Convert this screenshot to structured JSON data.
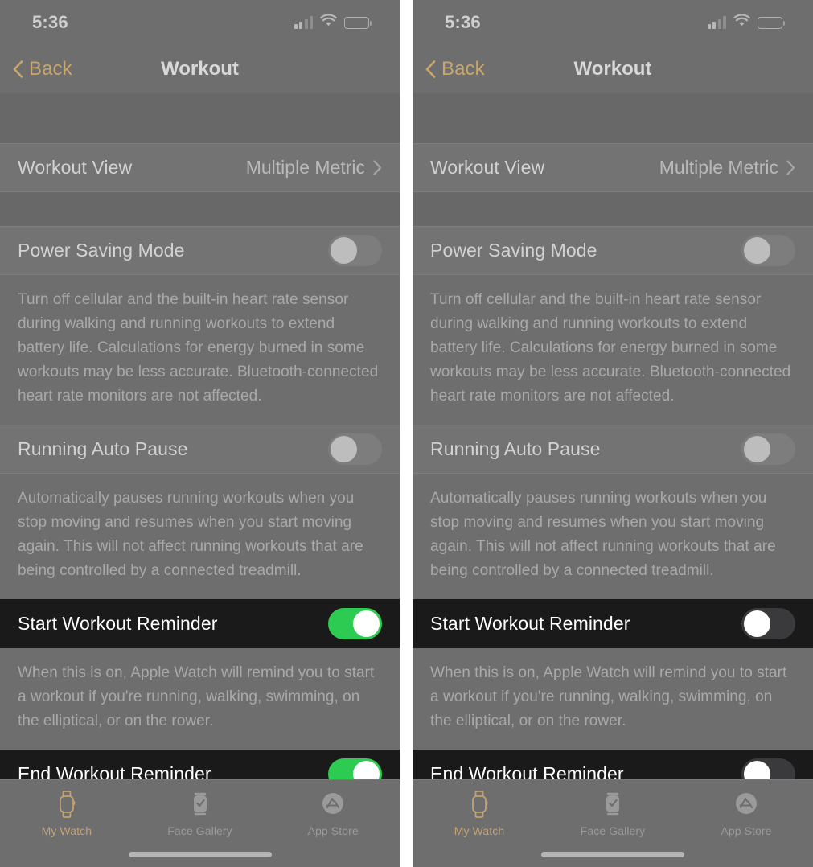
{
  "screens": [
    {
      "id": "left",
      "status_bar": {
        "time": "5:36",
        "cellular_icon": "cellular-signal-icon",
        "wifi_icon": "wifi-icon",
        "battery_icon": "battery-icon",
        "battery_level_pct": 50
      },
      "nav": {
        "back_label": "Back",
        "back_icon": "chevron-left-icon",
        "title": "Workout"
      },
      "rows": [
        {
          "key": "workout_view",
          "label": "Workout View",
          "value": "Multiple Metric",
          "accessory": "chevron-right-icon",
          "type": "disclosure",
          "highlighted": false
        },
        {
          "key": "power_saving_mode",
          "label": "Power Saving Mode",
          "type": "toggle",
          "toggle_state": "off",
          "highlighted": false,
          "description": "Turn off cellular and the built-in heart rate sensor during walking and running workouts to extend battery life. Calculations for energy burned in some workouts may be less accurate. Bluetooth-connected heart rate monitors are not affected."
        },
        {
          "key": "running_auto_pause",
          "label": "Running Auto Pause",
          "type": "toggle",
          "toggle_state": "off",
          "highlighted": false,
          "description": "Automatically pauses running workouts when you stop moving and resumes when you start moving again. This will not affect running workouts that are being controlled by a connected treadmill."
        },
        {
          "key": "start_workout_reminder",
          "label": "Start Workout Reminder",
          "type": "toggle",
          "toggle_state": "on",
          "highlighted": true,
          "description": "When this is on, Apple Watch will remind you to start a workout if you're running, walking, swimming, on the elliptical, or on the rower."
        },
        {
          "key": "end_workout_reminder",
          "label": "End Workout Reminder",
          "type": "toggle",
          "toggle_state": "on",
          "highlighted": true
        }
      ],
      "tabs": [
        {
          "label": "My Watch",
          "icon": "apple-watch-icon",
          "selected": true
        },
        {
          "label": "Face Gallery",
          "icon": "watch-face-icon",
          "selected": false
        },
        {
          "label": "App Store",
          "icon": "app-store-icon",
          "selected": false
        }
      ]
    },
    {
      "id": "right",
      "status_bar": {
        "time": "5:36",
        "cellular_icon": "cellular-signal-icon",
        "wifi_icon": "wifi-icon",
        "battery_icon": "battery-icon",
        "battery_level_pct": 50
      },
      "nav": {
        "back_label": "Back",
        "back_icon": "chevron-left-icon",
        "title": "Workout"
      },
      "rows": [
        {
          "key": "workout_view",
          "label": "Workout View",
          "value": "Multiple Metric",
          "accessory": "chevron-right-icon",
          "type": "disclosure",
          "highlighted": false
        },
        {
          "key": "power_saving_mode",
          "label": "Power Saving Mode",
          "type": "toggle",
          "toggle_state": "off",
          "highlighted": false,
          "description": "Turn off cellular and the built-in heart rate sensor during walking and running workouts to extend battery life. Calculations for energy burned in some workouts may be less accurate. Bluetooth-connected heart rate monitors are not affected."
        },
        {
          "key": "running_auto_pause",
          "label": "Running Auto Pause",
          "type": "toggle",
          "toggle_state": "off",
          "highlighted": false,
          "description": "Automatically pauses running workouts when you stop moving and resumes when you start moving again. This will not affect running workouts that are being controlled by a connected treadmill."
        },
        {
          "key": "start_workout_reminder",
          "label": "Start Workout Reminder",
          "type": "toggle",
          "toggle_state": "off",
          "highlighted": true,
          "description": "When this is on, Apple Watch will remind you to start a workout if you're running, walking, swimming, on the elliptical, or on the rower."
        },
        {
          "key": "end_workout_reminder",
          "label": "End Workout Reminder",
          "type": "toggle",
          "toggle_state": "off",
          "highlighted": true
        }
      ],
      "tabs": [
        {
          "label": "My Watch",
          "icon": "apple-watch-icon",
          "selected": true
        },
        {
          "label": "Face Gallery",
          "icon": "watch-face-icon",
          "selected": false
        },
        {
          "label": "App Store",
          "icon": "app-store-icon",
          "selected": false
        }
      ]
    }
  ],
  "colors": {
    "toggle_on": "#2ecb52",
    "accent_tint": "#c9a76a",
    "row_dim": "#737373",
    "row_active": "#1a1a1a",
    "page_dim": "#6e6e6e"
  }
}
